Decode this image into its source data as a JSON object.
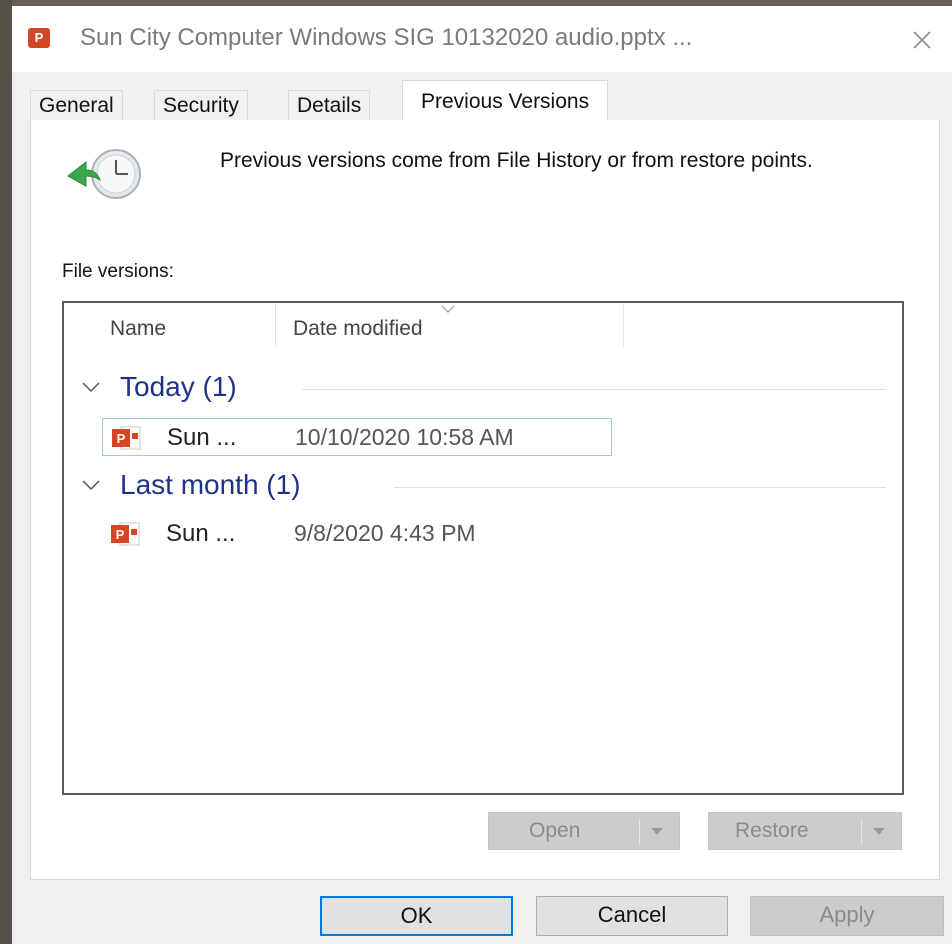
{
  "window": {
    "title": "Sun City Computer Windows SIG 10132020 audio.pptx ...",
    "icon": "powerpoint-file-icon",
    "close_icon": "close-icon"
  },
  "tabs": [
    {
      "label": "General",
      "active": false
    },
    {
      "label": "Security",
      "active": false
    },
    {
      "label": "Details",
      "active": false
    },
    {
      "label": "Previous Versions",
      "active": true
    }
  ],
  "panel": {
    "icon": "restore-clock-icon",
    "info_text": "Previous versions come from File History or from restore points.",
    "versions_label": "File versions:",
    "list": {
      "columns": [
        "Name",
        "Date modified"
      ],
      "groups": [
        {
          "label": "Today (1)",
          "items": [
            {
              "name": "Sun ...",
              "date": "10/10/2020 10:58 AM",
              "selected": true
            }
          ]
        },
        {
          "label": "Last month (1)",
          "items": [
            {
              "name": "Sun ...",
              "date": "9/8/2020 4:43 PM",
              "selected": false
            }
          ]
        }
      ]
    },
    "buttons": {
      "open": "Open",
      "restore": "Restore"
    }
  },
  "footer": {
    "ok": "OK",
    "cancel": "Cancel",
    "apply": "Apply"
  },
  "colors": {
    "group_header": "#1e3287",
    "ppt_red": "#d24726",
    "focus_blue": "#0078d7",
    "selection_border": "#99c9ef"
  }
}
